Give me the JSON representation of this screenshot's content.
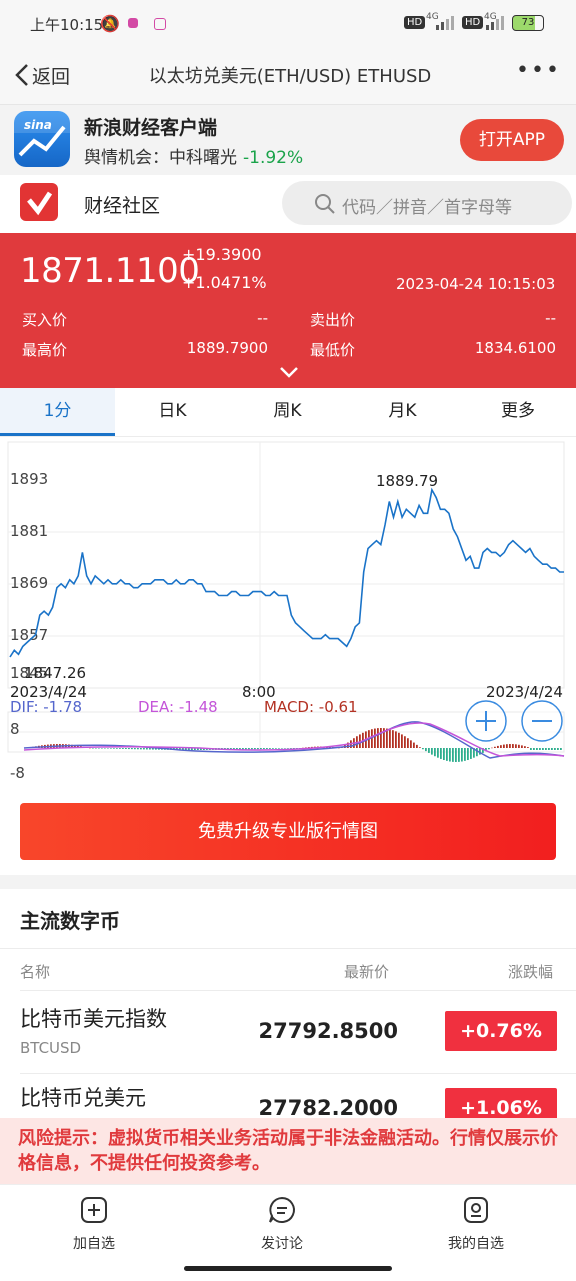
{
  "status_bar": {
    "time": "上午10:15",
    "network_1": "4G",
    "network_2": "4G",
    "battery": "73"
  },
  "nav": {
    "back_label": "返回",
    "title": "以太坊兑美元(ETH/USD) ETHUSD",
    "more": "•••"
  },
  "banner": {
    "logo_text": "sina",
    "title": "新浪财经客户端",
    "sub_prefix": "舆情机会：中科曙光",
    "sub_change": "-1.92%",
    "open_app_label": "打开APP"
  },
  "community": {
    "label": "财经社区",
    "search_placeholder": "代码／拼音／首字母等"
  },
  "quote": {
    "price": "1871.1100",
    "change_abs": "+19.3900",
    "change_pct": "+1.0471%",
    "timestamp": "2023-04-24 10:15:03",
    "bid_label": "买入价",
    "bid_value": "--",
    "ask_label": "卖出价",
    "ask_value": "--",
    "high_label": "最高价",
    "high_value": "1889.7900",
    "low_label": "最低价",
    "low_value": "1834.6100"
  },
  "tabs": [
    "1分",
    "日K",
    "周K",
    "月K",
    "更多"
  ],
  "chart_data": {
    "type": "line",
    "y_ticks": [
      "1893",
      "1881",
      "1869",
      "1857",
      "1845"
    ],
    "ylim": [
      1845,
      1893
    ],
    "x_labels": {
      "left": "2023/4/24",
      "middle": "8:00",
      "right": "2023/4/24"
    },
    "max_annotation": "1889.79",
    "min_annotation": "1847.26",
    "values": [
      1847.3,
      1849,
      1848,
      1850,
      1851,
      1852,
      1853,
      1858,
      1859,
      1858,
      1860,
      1865,
      1866,
      1865,
      1867,
      1866,
      1868,
      1874,
      1868,
      1866,
      1868,
      1867,
      1866,
      1867,
      1866,
      1866,
      1867,
      1866,
      1866,
      1865,
      1865,
      1866,
      1866,
      1866,
      1867,
      1867,
      1867,
      1866,
      1866,
      1867,
      1866,
      1866,
      1867,
      1867,
      1866,
      1866,
      1864,
      1864,
      1864,
      1863,
      1863,
      1863,
      1864,
      1864,
      1863,
      1863,
      1863,
      1864,
      1864,
      1864,
      1863,
      1863,
      1864,
      1863,
      1863,
      1863,
      1858,
      1856,
      1855,
      1854,
      1853,
      1852,
      1852,
      1852,
      1853,
      1852,
      1852,
      1852,
      1851,
      1850,
      1852,
      1855,
      1856,
      1869,
      1875,
      1876,
      1877,
      1876,
      1881,
      1887,
      1883,
      1887,
      1883,
      1885,
      1884,
      1883,
      1886,
      1884,
      1884,
      1890,
      1888,
      1885,
      1885,
      1884,
      1880,
      1878,
      1875,
      1872,
      1873,
      1870,
      1870,
      1874,
      1875,
      1874,
      1874,
      1873,
      1874,
      1876,
      1877,
      1876,
      1875,
      1874,
      1875,
      1873,
      1872,
      1871,
      1871,
      1870,
      1870,
      1869,
      1869
    ],
    "indicator": {
      "dif_label": "DIF: -1.78",
      "dea_label": "DEA: -1.48",
      "macd_label": "MACD: -0.61",
      "y_ticks": [
        "8",
        "-8"
      ]
    }
  },
  "upgrade_label": "免费升级专业版行情图",
  "section": {
    "title": "主流数字币",
    "col_name": "名称",
    "col_price": "最新价",
    "col_change": "涨跌幅",
    "rows": [
      {
        "name": "比特币美元指数",
        "code": "BTCUSD",
        "price": "27792.8500",
        "change": "+0.76%"
      },
      {
        "name": "比特币兑美元",
        "code": "",
        "price": "27782.2000",
        "change": "+1.06%"
      }
    ]
  },
  "risk": {
    "text": "风险提示：虚拟货币相关业务活动属于非法金融活动。行情仅展示价格信息，不提供任何投资参考。"
  },
  "bottom_nav": {
    "add_watchlist": "加自选",
    "discuss": "发讨论",
    "my_watchlist": "我的自选"
  },
  "colors": {
    "accent": "#e03a3d",
    "line": "#1a73c8",
    "up": "#b33224",
    "down": "#2fae8e"
  }
}
